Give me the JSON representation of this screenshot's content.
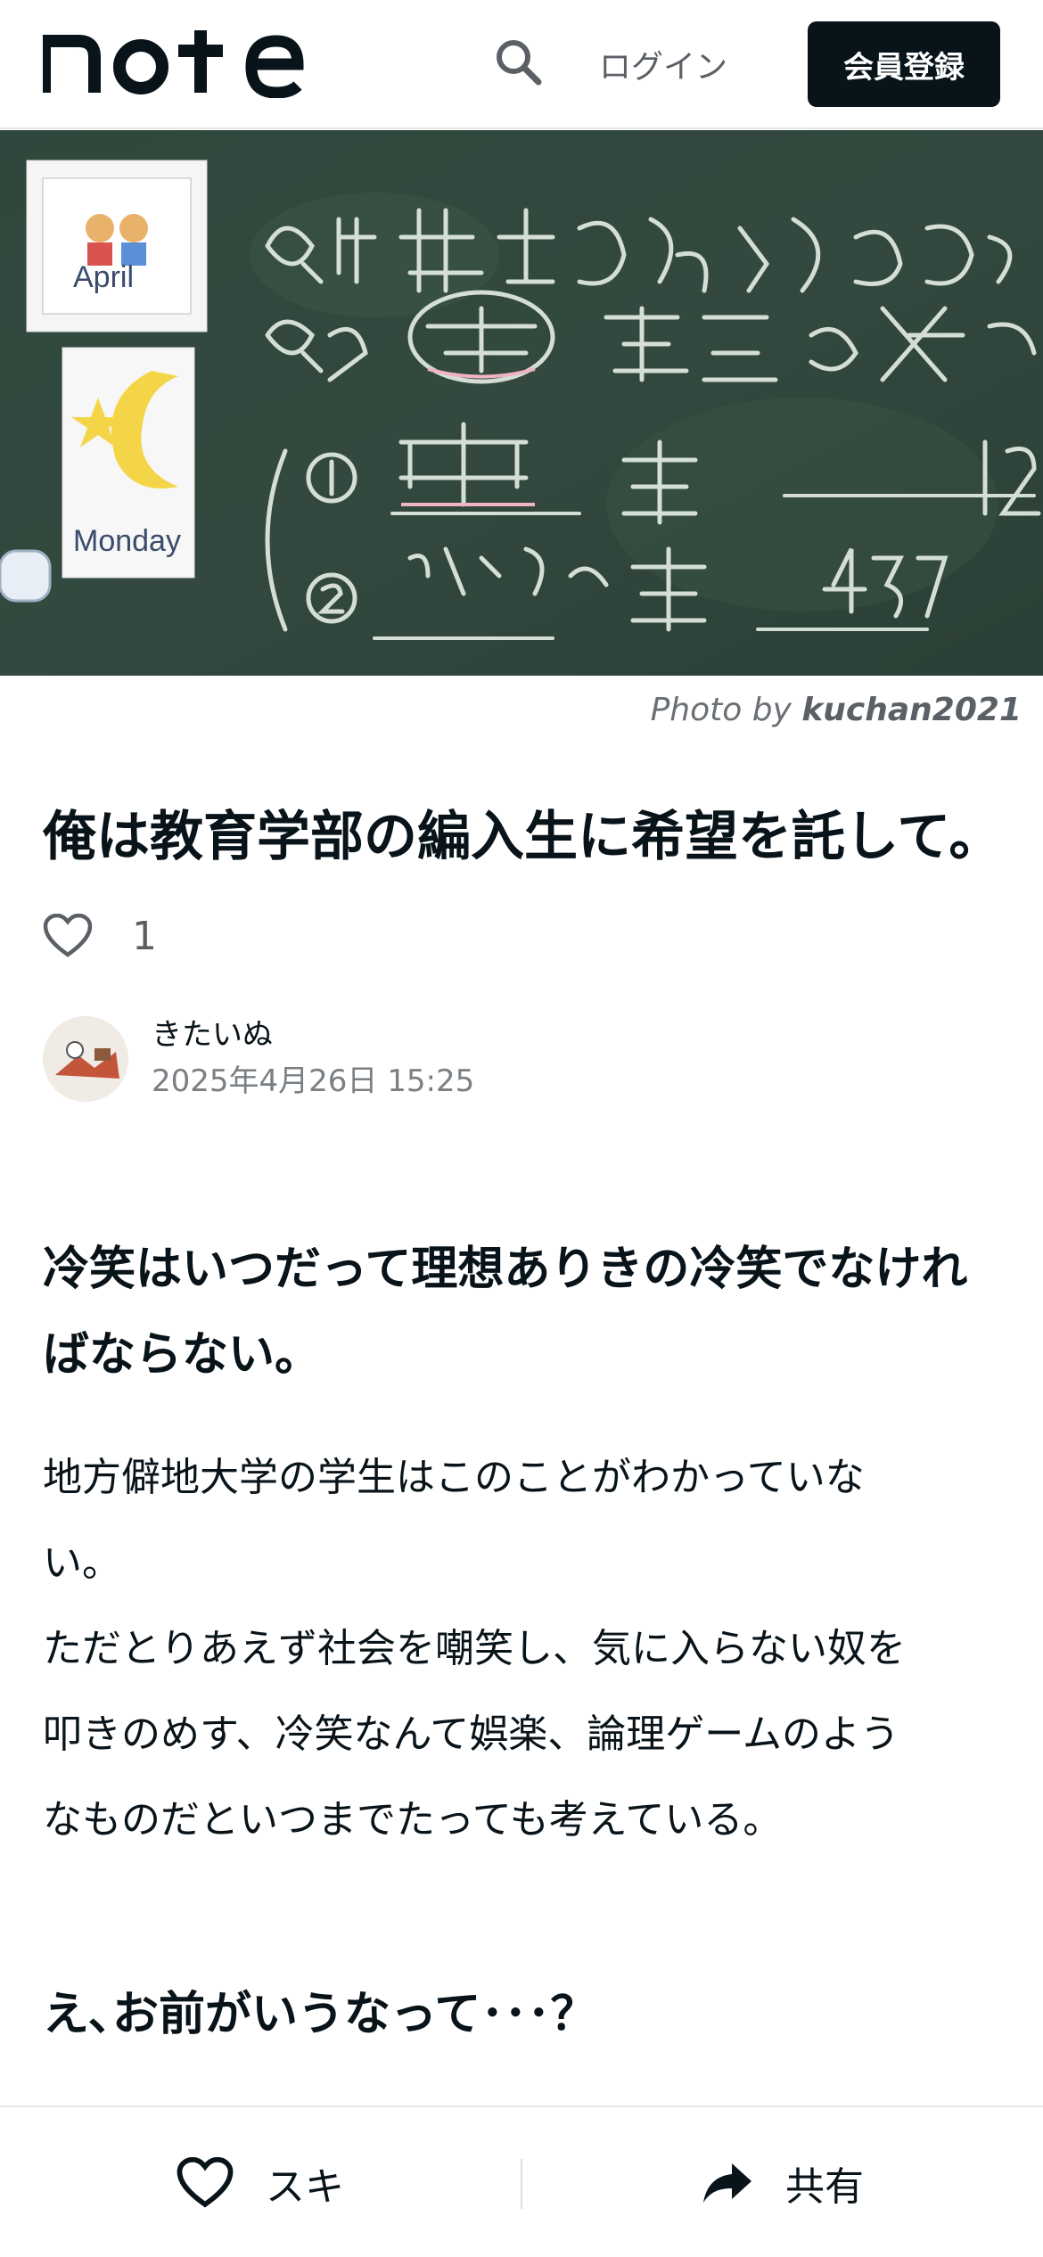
{
  "header": {
    "logo_text": "note",
    "login_label": "ログイン",
    "signup_label": "会員登録",
    "search_icon": "search-icon"
  },
  "hero": {
    "caption_prefix": "Photo by",
    "caption_author": "kuchan2021",
    "chalk_lines": [
      "Q1 世界にはどれくらいの",
      "Q2 母語 話者の 数が",
      "① 中国 語",
      "12",
      "② スペイン 語",
      "4.37"
    ],
    "card_labels": [
      "April",
      "Monday"
    ]
  },
  "article": {
    "title": "俺は教育学部の編入生に希望を託して。",
    "like_count": "1",
    "author_name": "きたいぬ",
    "date": "2025年4月26日 15:25",
    "heading1_line1": "冷笑はいつだって理想ありきの冷笑でなけれ",
    "heading1_line2": "ばならない。",
    "para_line1": "地方僻地大学の学生はこのことがわかっていな",
    "para_line2": "い。",
    "para_line3": "ただとりあえず社会を嘲笑し、気に入らない奴を",
    "para_line4": "叩きのめす、冷笑なんて娯楽、論理ゲームのよう",
    "para_line5": "なものだといつまでたっても考えている。",
    "heading2": "え､お前がいうなって･･･？"
  },
  "bottombar": {
    "like_label": "スキ",
    "share_label": "共有"
  },
  "colors": {
    "text": "#08131a",
    "muted": "#5b6066",
    "signup_bg": "#08131a",
    "chalkboard": "#2c4238"
  }
}
